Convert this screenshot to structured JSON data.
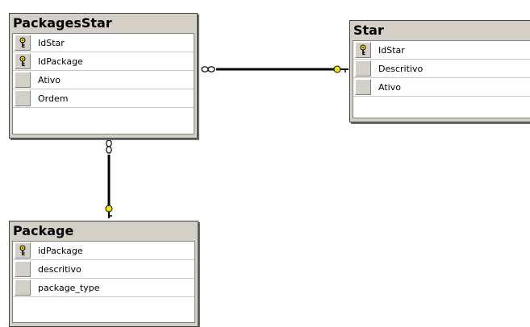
{
  "diagram": {
    "tables": [
      {
        "name": "PackagesStar",
        "columns": [
          {
            "name": "IdStar",
            "primary_key": true
          },
          {
            "name": "IdPackage",
            "primary_key": true
          },
          {
            "name": "Ativo",
            "primary_key": false
          },
          {
            "name": "Ordem",
            "primary_key": false
          }
        ]
      },
      {
        "name": "Star",
        "columns": [
          {
            "name": "IdStar",
            "primary_key": true
          },
          {
            "name": "Descritivo",
            "primary_key": false
          },
          {
            "name": "Ativo",
            "primary_key": false
          }
        ]
      },
      {
        "name": "Package",
        "columns": [
          {
            "name": "idPackage",
            "primary_key": true
          },
          {
            "name": "descritivo",
            "primary_key": false
          },
          {
            "name": "package_type",
            "primary_key": false
          }
        ]
      }
    ],
    "relationships": [
      {
        "from": "PackagesStar",
        "to": "Star",
        "from_end": "many",
        "to_end": "one"
      },
      {
        "from": "PackagesStar",
        "to": "Package",
        "from_end": "many",
        "to_end": "one"
      }
    ],
    "colors": {
      "table_header": "#d4d0c8",
      "table_border": "#404040",
      "key_icon": "#f2e600",
      "connector": "#000000"
    }
  }
}
